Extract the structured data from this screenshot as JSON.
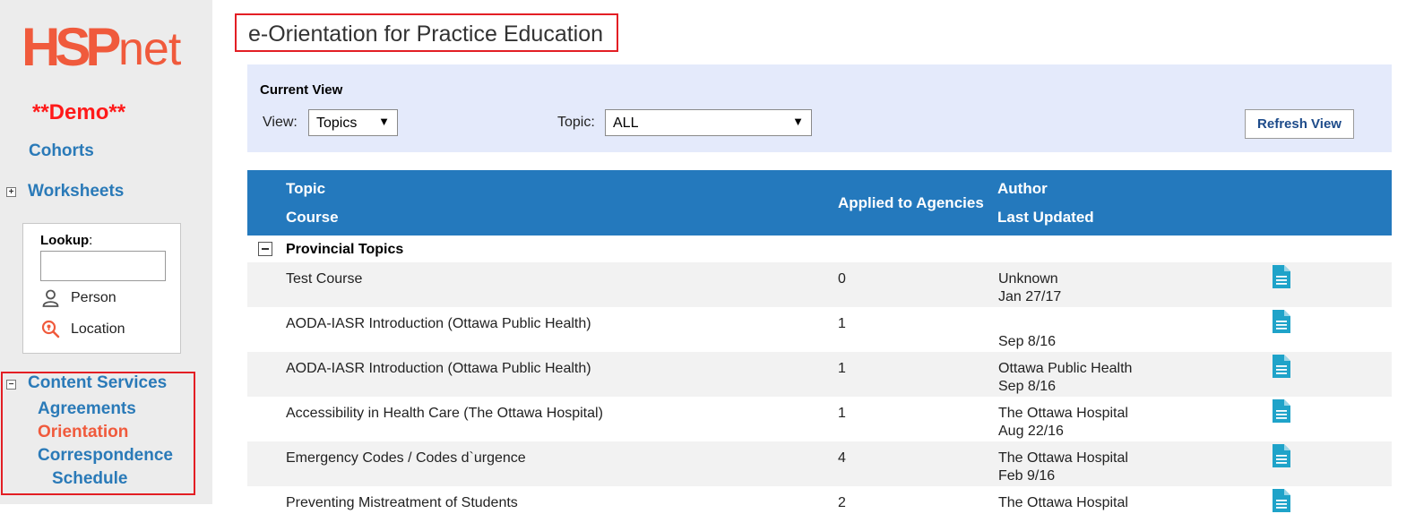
{
  "brand": {
    "logo_text_a": "HSP",
    "logo_text_b": "net",
    "demo_label": "**Demo**"
  },
  "sidebar": {
    "cohorts": "Cohorts",
    "worksheets": "Worksheets",
    "expand_symbol": "+",
    "collapse_symbol": "−",
    "lookup": {
      "label": "Lookup",
      "label_suffix": ":",
      "input_value": "",
      "options": [
        "Person",
        "Location"
      ]
    },
    "content_services": {
      "label": "Content Services",
      "items": [
        "Agreements",
        "Orientation",
        "Correspondence",
        "Schedule"
      ],
      "active": "Orientation"
    }
  },
  "page": {
    "title": "e-Orientation for Practice Education"
  },
  "view_panel": {
    "heading": "Current View",
    "view_label": "View:",
    "view_value": "Topics",
    "topic_label": "Topic:",
    "topic_value": "ALL",
    "refresh_label": "Refresh View",
    "dropdown_arrow": "▼"
  },
  "table": {
    "headers": {
      "topic": "Topic",
      "course": "Course",
      "applied": "Applied to Agencies",
      "author": "Author",
      "last_updated": "Last Updated"
    },
    "group": "Provincial Topics",
    "rows": [
      {
        "course": "Test Course",
        "count": "0",
        "author": "Unknown",
        "date": "Jan 27/17"
      },
      {
        "course": "AODA-IASR Introduction (Ottawa Public Health)",
        "count": "1",
        "author": "",
        "date": "Sep 8/16"
      },
      {
        "course": "AODA-IASR Introduction (Ottawa Public Health)",
        "count": "1",
        "author": "Ottawa Public Health",
        "date": "Sep 8/16"
      },
      {
        "course": "Accessibility in Health Care (The Ottawa Hospital)",
        "count": "1",
        "author": "The Ottawa Hospital",
        "date": "Aug 22/16"
      },
      {
        "course": "Emergency Codes / Codes d`urgence",
        "count": "4",
        "author": "The Ottawa Hospital",
        "date": "Feb 9/16"
      },
      {
        "course": "Preventing Mistreatment of Students",
        "count": "2",
        "author": "The Ottawa Hospital",
        "date": ""
      }
    ]
  },
  "colors": {
    "brand_orange": "#f05a3c",
    "link_blue": "#2a7ab8",
    "header_blue": "#2479bd",
    "highlight_red": "#e31e24",
    "doc_icon_teal": "#1fa3c9",
    "panel_bg": "#e4eafb"
  }
}
